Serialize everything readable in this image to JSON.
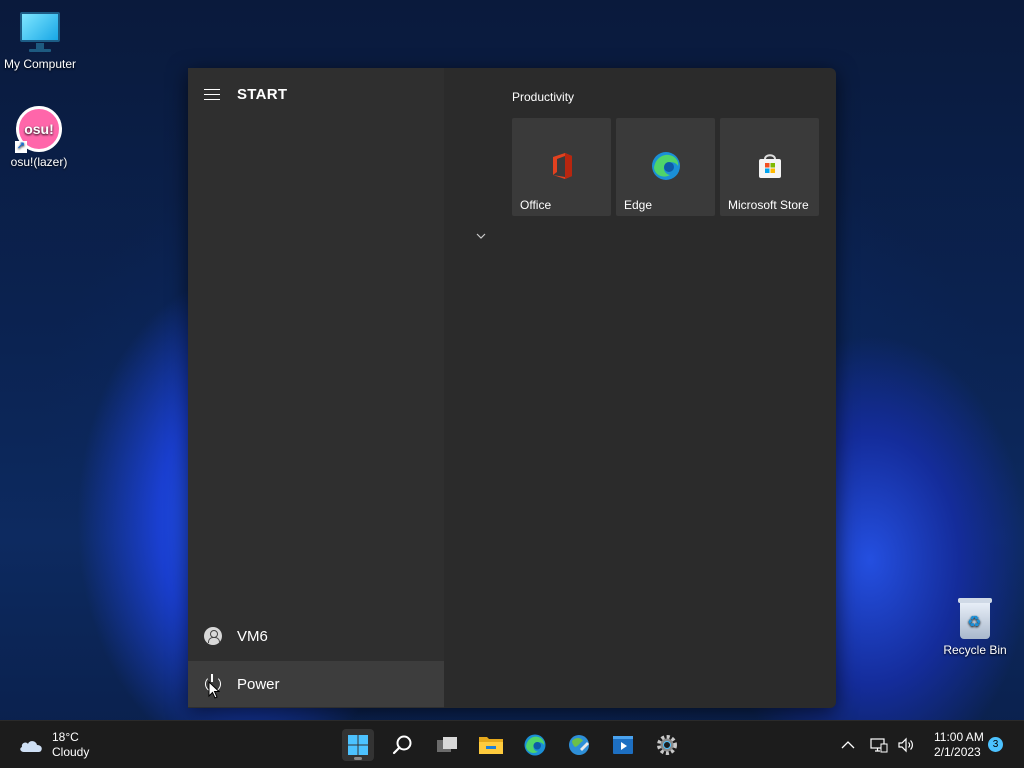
{
  "desktop": {
    "icons": [
      {
        "label": "My Computer"
      },
      {
        "label": "osu!(lazer)",
        "badge": "osu!"
      },
      {
        "label": "Recycle Bin"
      }
    ]
  },
  "start_menu": {
    "title": "START",
    "user": {
      "label": "VM6"
    },
    "power": {
      "label": "Power"
    },
    "group": {
      "label": "Productivity"
    },
    "tiles": [
      {
        "label": "Office",
        "icon": "office-icon"
      },
      {
        "label": "Edge",
        "icon": "edge-icon"
      },
      {
        "label": "Microsoft Store",
        "icon": "store-icon"
      }
    ]
  },
  "taskbar": {
    "weather": {
      "temp": "18°C",
      "condition": "Cloudy"
    },
    "apps": [
      "start-icon",
      "search-icon",
      "task-view-icon",
      "file-explorer-icon",
      "edge-icon",
      "control-panel-icon",
      "media-player-icon",
      "settings-icon"
    ],
    "clock": {
      "time": "11:00 AM",
      "date": "2/1/2023"
    },
    "notifications": "3"
  },
  "colors": {
    "accent": "#4cc2ff",
    "start_bg": "#2b2b2b",
    "taskbar_bg": "#1c1c1c"
  }
}
